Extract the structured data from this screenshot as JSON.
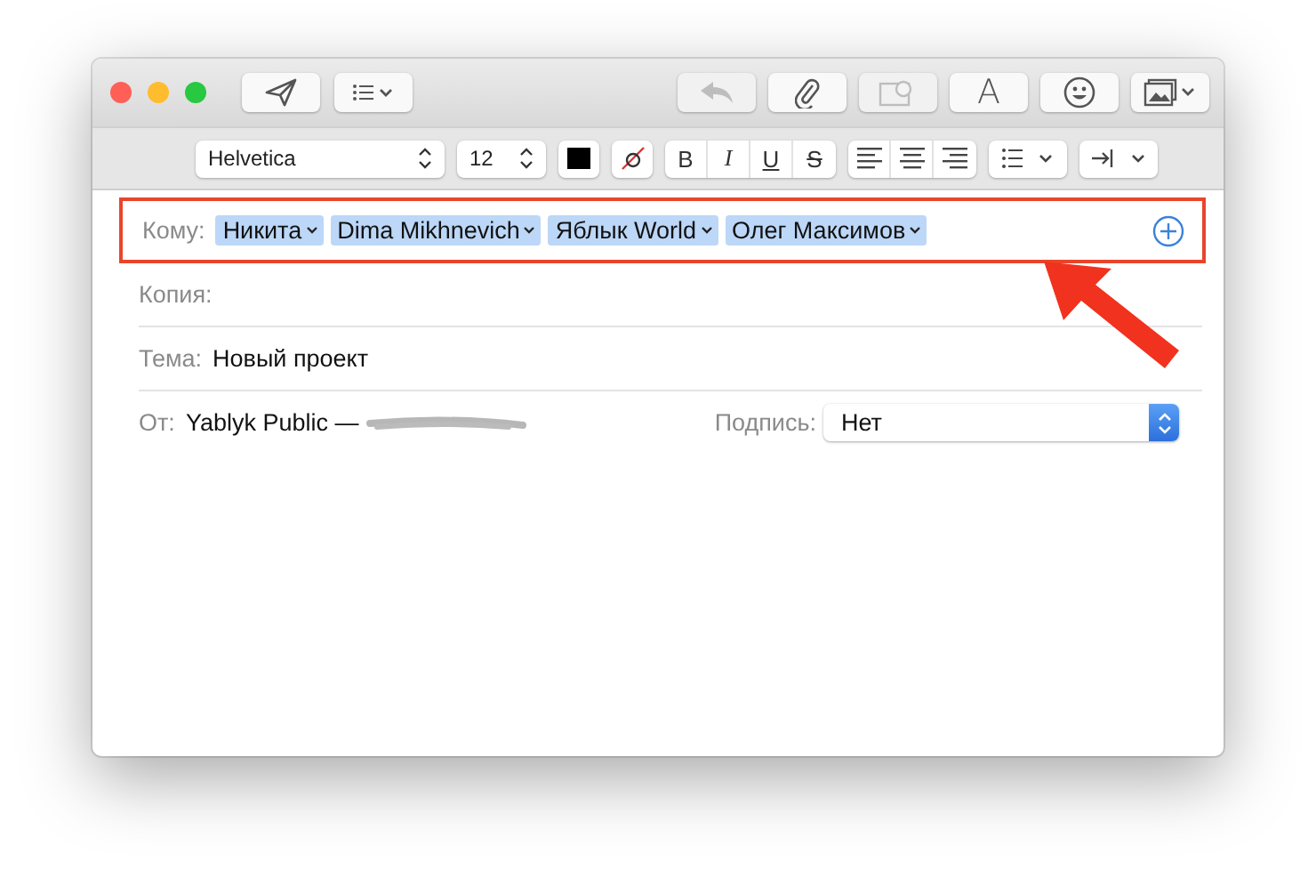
{
  "window": {
    "controls": [
      {
        "kind": "close"
      },
      {
        "kind": "minimize"
      },
      {
        "kind": "zoom"
      }
    ]
  },
  "toolbar": {
    "left": [
      {
        "kind": "send"
      },
      {
        "kind": "header-fields"
      }
    ],
    "right": [
      {
        "kind": "reply",
        "disabled": true
      },
      {
        "kind": "attach",
        "disabled": false
      },
      {
        "kind": "markup",
        "disabled": true
      },
      {
        "kind": "fonts",
        "label": "A",
        "disabled": false
      },
      {
        "kind": "emoji",
        "disabled": false
      },
      {
        "kind": "photos",
        "disabled": false
      }
    ]
  },
  "format_bar": {
    "font": "Helvetica",
    "size": "12",
    "styles": [
      {
        "kind": "bold",
        "label": "B"
      },
      {
        "kind": "italic",
        "label": "I"
      },
      {
        "kind": "underline",
        "label": "U"
      },
      {
        "kind": "strike",
        "label": "S"
      }
    ]
  },
  "header": {
    "to": {
      "label": "Кому:",
      "recipients": [
        "Никита",
        "Dima Mikhnevich",
        "Яблык World",
        "Олег Максимов"
      ]
    },
    "cc": {
      "label": "Копия:"
    },
    "subject": {
      "label": "Тема:",
      "value": "Новый проект"
    },
    "from": {
      "label": "От:",
      "value": "Yablyk Public —",
      "signature_label": "Подпись:",
      "signature": "Нет"
    }
  },
  "annotation": {
    "highlight": true,
    "arrow": true
  }
}
